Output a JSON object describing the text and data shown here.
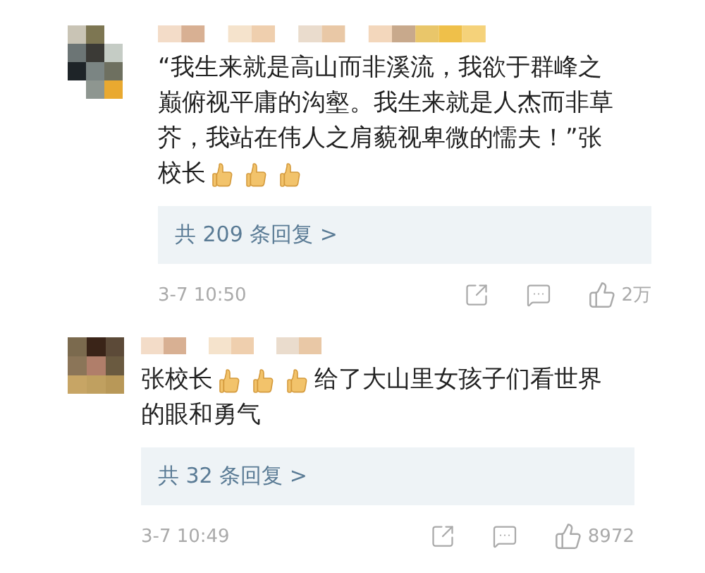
{
  "comments": [
    {
      "lines": [
        [
          {
            "kind": "text",
            "text": "“我生来就是高山而非溪流，我欲于群峰之"
          }
        ],
        [
          {
            "kind": "text",
            "text": "巅俯视平庸的沟壑。我生来就是人杰而非草"
          }
        ],
        [
          {
            "kind": "text",
            "text": "芥，我站在伟人之肩藐视卑微的懦夫！”张"
          }
        ],
        [
          {
            "kind": "text",
            "text": "校长"
          },
          {
            "kind": "emoji"
          },
          {
            "kind": "emoji"
          },
          {
            "kind": "emoji"
          }
        ]
      ],
      "replies": "共 209 条回复 >",
      "time": "3-7 10:50",
      "likes": "2万"
    },
    {
      "lines": [
        [
          {
            "kind": "text",
            "text": "张校长"
          },
          {
            "kind": "emoji"
          },
          {
            "kind": "emoji"
          },
          {
            "kind": "emoji"
          },
          {
            "kind": "text",
            "text": "给了大山里女孩子们看世界"
          }
        ],
        [
          {
            "kind": "text",
            "text": "的眼和勇气"
          }
        ]
      ],
      "replies": "共 32 条回复 >",
      "time": "3-7 10:49",
      "likes": "8972"
    }
  ]
}
